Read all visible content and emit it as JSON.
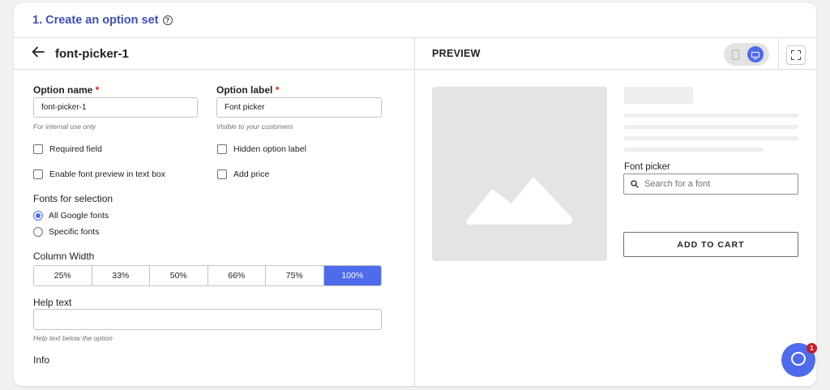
{
  "header": {
    "title": "1. Create an option set"
  },
  "editor": {
    "option_set_name": "font-picker-1",
    "option_name": {
      "label": "Option name",
      "required_mark": "*",
      "value": "font-picker-1",
      "hint": "For internal use only"
    },
    "option_label": {
      "label": "Option label",
      "required_mark": "*",
      "value": "Font picker",
      "hint": "Visible to your customers"
    },
    "checkboxes": {
      "required_field": "Required field",
      "hidden_option_label": "Hidden option label",
      "font_preview": "Enable font preview in text box",
      "add_price": "Add price"
    },
    "fonts_for_selection": {
      "label": "Fonts for selection",
      "options": [
        "All Google fonts",
        "Specific fonts"
      ],
      "selected": "All Google fonts"
    },
    "column_width": {
      "label": "Column Width",
      "options": [
        "25%",
        "33%",
        "50%",
        "66%",
        "75%",
        "100%"
      ],
      "selected": "100%"
    },
    "help_text": {
      "label": "Help text",
      "value": "",
      "hint": "Help text below the option"
    },
    "info": {
      "label": "Info"
    }
  },
  "preview": {
    "title": "PREVIEW",
    "device_selected": "desktop",
    "font_picker_label": "Font picker",
    "search_placeholder": "Search for a font",
    "add_to_cart": "ADD TO CART"
  },
  "chat": {
    "badge_count": "1"
  },
  "colors": {
    "accent": "#4e6bec",
    "title": "#3e4eb8",
    "required": "#d82c0d",
    "badge": "#c4202c"
  }
}
